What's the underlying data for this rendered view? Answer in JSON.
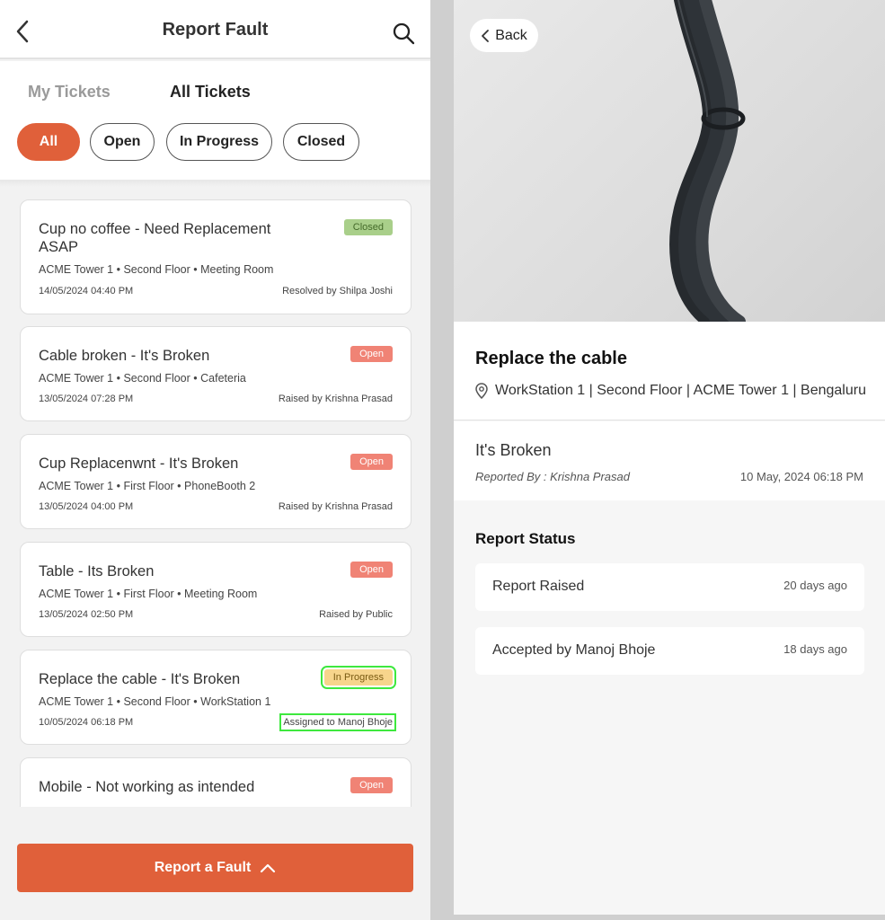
{
  "left": {
    "title": "Report Fault",
    "tabs": [
      "My Tickets",
      "All Tickets"
    ],
    "filters": [
      "All",
      "Open",
      "In Progress",
      "Closed"
    ],
    "tickets": [
      {
        "title": "Cup no coffee - Need Replacement ASAP",
        "status": "Closed",
        "location": "ACME Tower 1 • Second Floor • Meeting Room",
        "date": "14/05/2024 04:40 PM",
        "person": "Resolved by Shilpa Joshi"
      },
      {
        "title": "Cable broken  - It's Broken",
        "status": "Open",
        "location": "ACME Tower 1 • Second Floor • Cafeteria",
        "date": "13/05/2024 07:28 PM",
        "person": "Raised by Krishna Prasad"
      },
      {
        "title": "Cup Replacenwnt - It's Broken",
        "status": "Open",
        "location": "ACME Tower 1 • First Floor • PhoneBooth 2",
        "date": "13/05/2024 04:00 PM",
        "person": "Raised by Krishna Prasad"
      },
      {
        "title": "Table - Its Broken",
        "status": "Open",
        "location": "ACME Tower 1 • First Floor • Meeting Room",
        "date": "13/05/2024 02:50 PM",
        "person": "Raised by Public"
      },
      {
        "title": "Replace the cable - It's Broken",
        "status": "In Progress",
        "location": "ACME Tower 1 • Second Floor • WorkStation 1",
        "date": "10/05/2024 06:18 PM",
        "person": "Assigned to Manoj Bhoje"
      },
      {
        "title": "Mobile  - Not working as intended",
        "status": "Open"
      }
    ],
    "report_button": "Report a Fault"
  },
  "right": {
    "back_label": "Back",
    "title": "Replace the cable",
    "address": "WorkStation 1 | Second Floor | ACME Tower 1 | Bengaluru",
    "description": "It's Broken",
    "reported_by": "Reported By : Krishna Prasad",
    "reported_at": "10 May, 2024 06:18 PM",
    "status_heading": "Report Status",
    "statuses": [
      {
        "label": "Report Raised",
        "ago": "20 days ago"
      },
      {
        "label": "Accepted by Manoj Bhoje",
        "ago": "18 days ago"
      }
    ]
  },
  "colors": {
    "accent": "#e0603a",
    "closed": "#a9cf8a",
    "open": "#f08375",
    "in_progress": "#f7d58c"
  }
}
